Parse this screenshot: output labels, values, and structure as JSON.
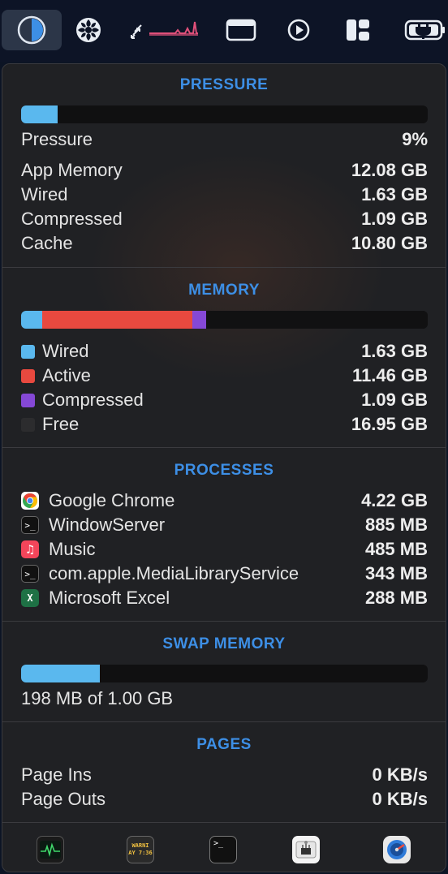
{
  "menubar": {
    "items": [
      {
        "name": "memory-pie-icon"
      },
      {
        "name": "fan-icon"
      },
      {
        "name": "network-sparkline-icon"
      },
      {
        "name": "window-icon"
      },
      {
        "name": "play-icon"
      },
      {
        "name": "layout-icon"
      },
      {
        "name": "battery-charging-icon"
      }
    ]
  },
  "pressure": {
    "title": "PRESSURE",
    "level_fraction": 0.09,
    "rows": [
      {
        "label": "Pressure",
        "value": "9%"
      },
      {
        "label": "App Memory",
        "value": "12.08 GB"
      },
      {
        "label": "Wired",
        "value": "1.63 GB"
      },
      {
        "label": "Compressed",
        "value": "1.09 GB"
      },
      {
        "label": "Cache",
        "value": "10.80 GB"
      }
    ],
    "bar_color": "#5ab8ee"
  },
  "memory": {
    "title": "MEMORY",
    "segments": [
      {
        "label": "Wired",
        "value": "1.63 GB",
        "gb": 1.63,
        "color": "#5ab8ee"
      },
      {
        "label": "Active",
        "value": "11.46 GB",
        "gb": 11.46,
        "color": "#e8493f"
      },
      {
        "label": "Compressed",
        "value": "1.09 GB",
        "gb": 1.09,
        "color": "#8548d6"
      },
      {
        "label": "Free",
        "value": "16.95 GB",
        "gb": 16.95,
        "color": "#111112"
      }
    ]
  },
  "processes": {
    "title": "PROCESSES",
    "items": [
      {
        "name": "Google Chrome",
        "value": "4.22 GB",
        "icon": "chrome-icon"
      },
      {
        "name": "WindowServer",
        "value": "885 MB",
        "icon": "terminal-exec-icon"
      },
      {
        "name": "Music",
        "value": "485 MB",
        "icon": "music-icon"
      },
      {
        "name": "com.apple.MediaLibraryService",
        "value": "343 MB",
        "icon": "terminal-exec-icon"
      },
      {
        "name": "Microsoft Excel",
        "value": "288 MB",
        "icon": "excel-icon"
      }
    ]
  },
  "swap": {
    "title": "SWAP MEMORY",
    "used_fraction": 0.193,
    "summary": "198 MB of 1.00 GB"
  },
  "pages": {
    "title": "PAGES",
    "rows": [
      {
        "label": "Page Ins",
        "value": "0 KB/s"
      },
      {
        "label": "Page Outs",
        "value": "0 KB/s"
      }
    ]
  },
  "dock": {
    "buttons": [
      {
        "name": "activity-monitor-icon"
      },
      {
        "name": "console-icon",
        "text_line1": "WARNI",
        "text_line2": "AY 7:36"
      },
      {
        "name": "terminal-icon"
      },
      {
        "name": "system-information-icon"
      },
      {
        "name": "disk-utility-icon"
      }
    ]
  }
}
